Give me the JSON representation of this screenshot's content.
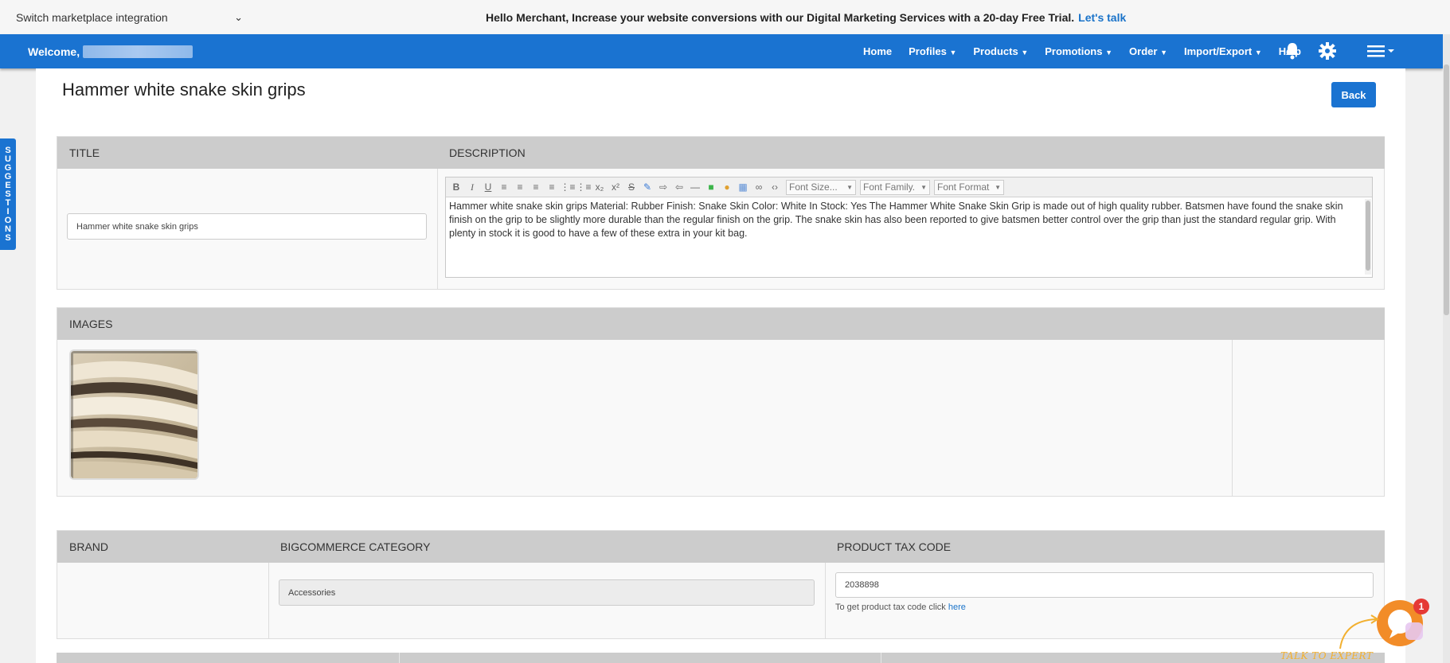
{
  "topbar": {
    "switch_label": "Switch marketplace integration",
    "promo_text": "Hello Merchant, Increase your website conversions with our Digital Marketing Services with a 20-day Free Trial.",
    "promo_link": "Let's talk"
  },
  "nav": {
    "welcome": "Welcome,",
    "links": [
      "Home",
      "Profiles",
      "Products",
      "Promotions",
      "Order",
      "Import/Export",
      "Help"
    ],
    "bell_icon": "bell-icon",
    "gear_icon": "gear-icon",
    "menu_icon": "hamburger-menu-icon"
  },
  "suggestions": {
    "label_chars": [
      "S",
      "U",
      "G",
      "G",
      "E",
      "S",
      "T",
      "I",
      "O",
      "N",
      "S"
    ]
  },
  "page": {
    "title": "Hammer white snake skin grips",
    "back_label": "Back"
  },
  "title_section": {
    "title_header": "TITLE",
    "description_header": "DESCRIPTION",
    "title_value": "Hammer white snake skin grips",
    "toolbar_dropdowns": [
      "Font Size...",
      "Font Family.",
      "Font Format"
    ],
    "description": "Hammer white snake skin grips Material: Rubber Finish: Snake Skin Color: White In Stock: Yes   The Hammer White Snake Skin Grip is made out of high quality rubber. Batsmen have found the snake skin finish on the grip to be slightly more durable than the regular finish on the grip. The snake skin has also been reported to give batsmen better control over the grip than just the standard regular grip. With plenty in stock it is good to have a few of these extra in your kit bag."
  },
  "images_section": {
    "header": "IMAGES"
  },
  "attributes_section": {
    "brand_header": "BRAND",
    "category_header": "BIGCOMMERCE CATEGORY",
    "taxcode_header": "PRODUCT TAX CODE",
    "category_value": "Accessories",
    "taxcode_value": "2038898",
    "taxcode_help": "To get product tax code click",
    "taxcode_link": "here"
  },
  "chat_widget": {
    "badge_count": "1",
    "label": "TALK TO EXPERT"
  },
  "colors": {
    "brand_blue": "#1a73d1",
    "header_gray": "#cccccc",
    "badge_red": "#e53935",
    "chat_orange": "#f28c28"
  }
}
